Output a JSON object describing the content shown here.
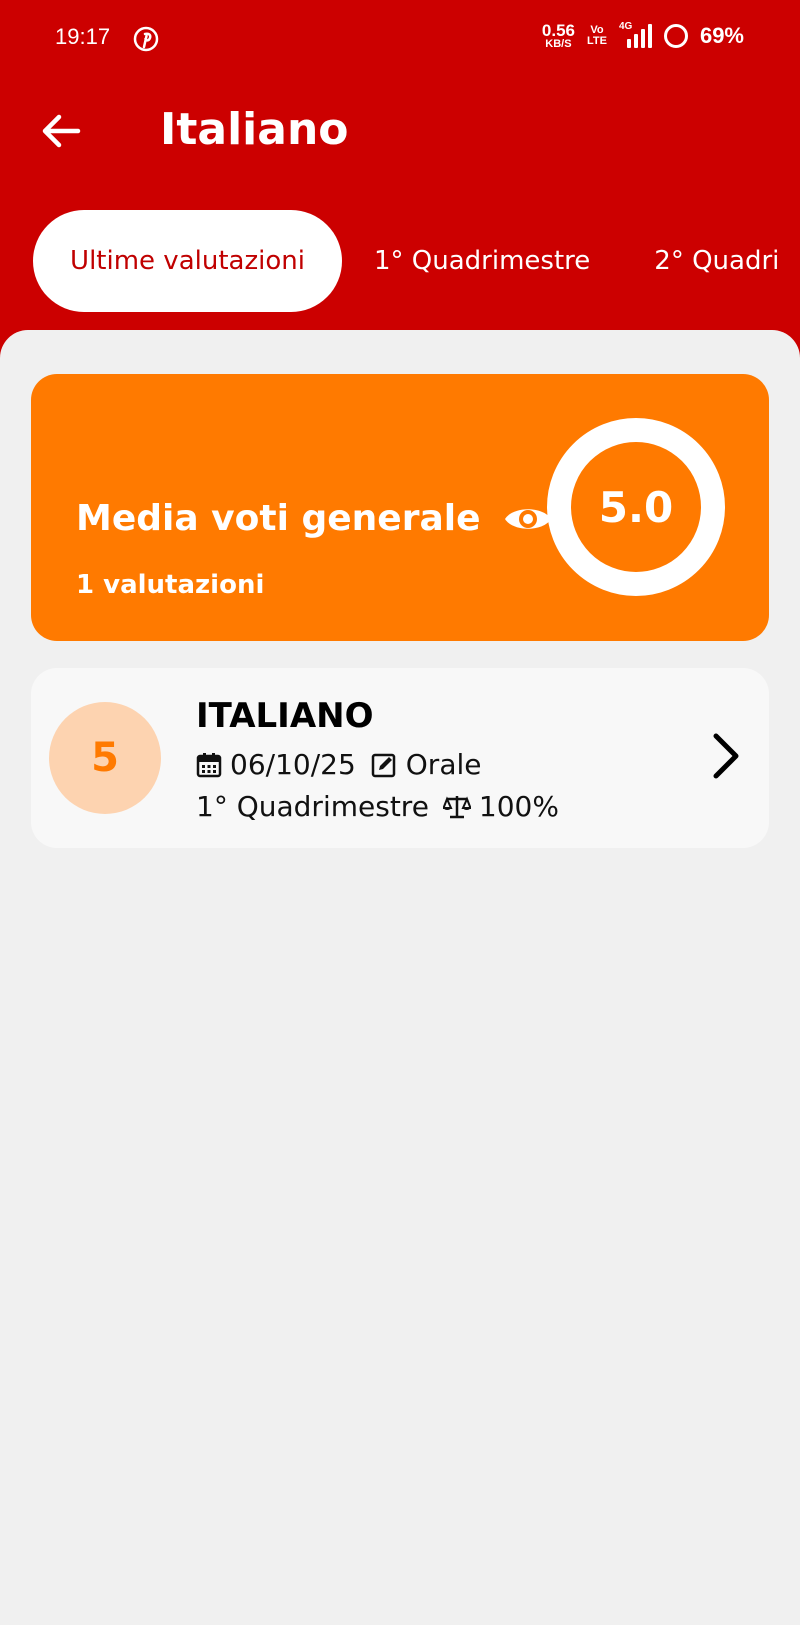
{
  "status_bar": {
    "time": "19:17",
    "net_speed_value": "0.56",
    "net_speed_unit": "KB/S",
    "volte_top": "Vo",
    "volte_bottom": "LTE",
    "network": "4G",
    "battery": "69%",
    "icons": [
      "pinterest-icon",
      "signal-icon",
      "battery-icon"
    ]
  },
  "header": {
    "title": "Italiano",
    "back_icon": "arrow-left-icon"
  },
  "tabs": [
    {
      "label": "Ultime valutazioni",
      "active": true
    },
    {
      "label": "1° Quadrimestre",
      "active": false
    },
    {
      "label": "2° Quadri",
      "active": false
    }
  ],
  "average_card": {
    "label": "Media voti generale",
    "count_text": "1 valutazioni",
    "value": "5.0",
    "icon": "eye-icon",
    "color": "#ff7a00"
  },
  "grades": [
    {
      "grade": "5",
      "subject": "ITALIANO",
      "date": "06/10/25",
      "type": "Orale",
      "period": "1° Quadrimestre",
      "weight": "100%",
      "icons": [
        "calendar-icon",
        "edit-icon",
        "scale-icon",
        "chevron-right-icon"
      ]
    }
  ],
  "colors": {
    "header": "#cc0000",
    "accent": "#ff7a00",
    "grade_circle": "#fdd3b0"
  }
}
